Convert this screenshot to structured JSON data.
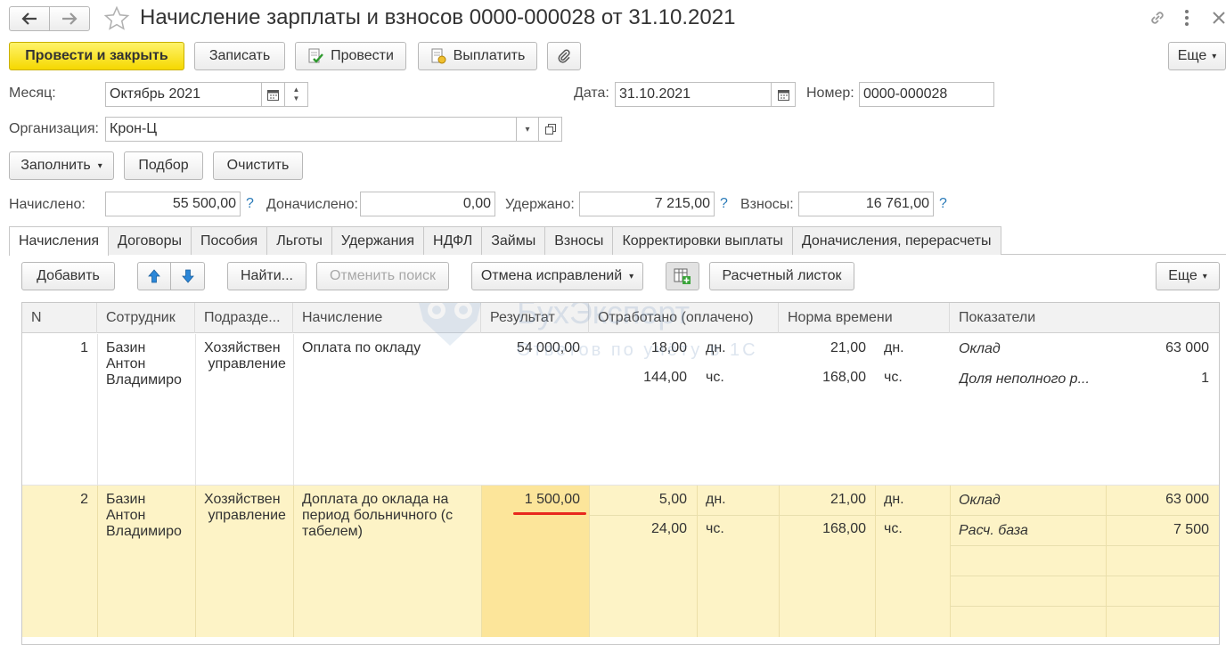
{
  "window": {
    "title": "Начисление зарплаты и взносов 0000-000028 от 31.10.2021"
  },
  "toolbar": {
    "post_close": "Провести и закрыть",
    "save": "Записать",
    "post": "Провести",
    "pay": "Выплатить",
    "more": "Еще"
  },
  "form": {
    "month_label": "Месяц:",
    "month_value": "Октябрь 2021",
    "date_label": "Дата:",
    "date_value": "31.10.2021",
    "number_label": "Номер:",
    "number_value": "0000-000028",
    "org_label": "Организация:",
    "org_value": "Крон-Ц"
  },
  "actions": {
    "fill": "Заполнить",
    "select": "Подбор",
    "clear": "Очистить"
  },
  "totals": {
    "accrued_label": "Начислено:",
    "accrued_value": "55 500,00",
    "extra_label": "Доначислено:",
    "extra_value": "0,00",
    "withheld_label": "Удержано:",
    "withheld_value": "7 215,00",
    "contrib_label": "Взносы:",
    "contrib_value": "16 761,00",
    "help": "?"
  },
  "tabs": [
    "Начисления",
    "Договоры",
    "Пособия",
    "Льготы",
    "Удержания",
    "НДФЛ",
    "Займы",
    "Взносы",
    "Корректировки выплаты",
    "Доначисления, перерасчеты"
  ],
  "grid_toolbar": {
    "add": "Добавить",
    "find": "Найти...",
    "cancel_search": "Отменить поиск",
    "cancel_corrections": "Отмена исправлений",
    "payslip": "Расчетный листок",
    "more": "Еще"
  },
  "columns": [
    "N",
    "Сотрудник",
    "Подразде...",
    "Начисление",
    "Результат",
    "Отработано (оплачено)",
    "Норма времени",
    "Показатели"
  ],
  "rows": [
    {
      "n": "1",
      "employee": "Базин\nАнтон\nВладимиро",
      "dept": "Хозяйствен\n управление",
      "accrual": "Оплата по окладу",
      "result": "54 000,00",
      "worked": [
        "18,00",
        "144,00"
      ],
      "worked_units": [
        "дн.",
        "чс."
      ],
      "norm": [
        "21,00",
        "168,00"
      ],
      "norm_units": [
        "дн.",
        "чс."
      ],
      "indicators": [
        {
          "name": "Оклад",
          "value": "63 000"
        },
        {
          "name": "Доля неполного р...",
          "value": "1"
        }
      ]
    },
    {
      "n": "2",
      "employee": "Базин\nАнтон\nВладимиро",
      "dept": "Хозяйствен\n управление",
      "accrual": "Доплата до оклада на\nпериод больничного (с\nтабелем)",
      "result": "1 500,00",
      "worked": [
        "5,00",
        "24,00"
      ],
      "worked_units": [
        "дн.",
        "чс."
      ],
      "norm": [
        "21,00",
        "168,00"
      ],
      "norm_units": [
        "дн.",
        "чс."
      ],
      "indicators": [
        {
          "name": "Оклад",
          "value": "63 000"
        },
        {
          "name": "Расч. база",
          "value": "7 500"
        }
      ]
    }
  ],
  "watermark": {
    "brand": "БухЭксперт",
    "tagline": "Ответов по учёту в 1С"
  },
  "colors": {
    "primary": "#f5d800",
    "selected_row": "#fdf3c6",
    "selected_cell": "#fce59a",
    "underline": "#e8281e",
    "help": "#2a7ab8"
  }
}
